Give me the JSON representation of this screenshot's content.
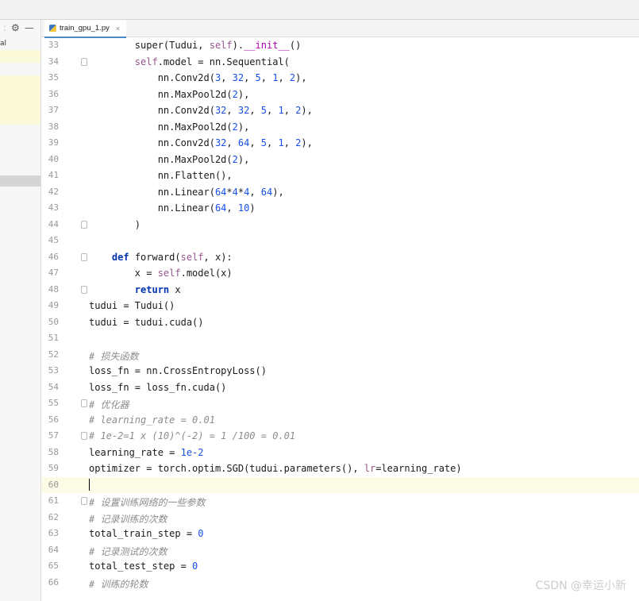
{
  "tab": {
    "filename": "train_gpu_1.py",
    "icon": "python-file-icon",
    "close_symbol": "×"
  },
  "left_panel": {
    "label": "al",
    "settings_icon": "gear-icon",
    "minimize_icon": "minus-icon"
  },
  "editor": {
    "current_line": 60,
    "lines": [
      {
        "n": "33",
        "t": "        super(Tudui, self).__init__()"
      },
      {
        "n": "34",
        "t": "        self.model = nn.Sequential("
      },
      {
        "n": "35",
        "t": "            nn.Conv2d(3, 32, 5, 1, 2),"
      },
      {
        "n": "36",
        "t": "            nn.MaxPool2d(2),"
      },
      {
        "n": "37",
        "t": "            nn.Conv2d(32, 32, 5, 1, 2),"
      },
      {
        "n": "38",
        "t": "            nn.MaxPool2d(2),"
      },
      {
        "n": "39",
        "t": "            nn.Conv2d(32, 64, 5, 1, 2),"
      },
      {
        "n": "40",
        "t": "            nn.MaxPool2d(2),"
      },
      {
        "n": "41",
        "t": "            nn.Flatten(),"
      },
      {
        "n": "42",
        "t": "            nn.Linear(64*4*4, 64),"
      },
      {
        "n": "43",
        "t": "            nn.Linear(64, 10)"
      },
      {
        "n": "44",
        "t": "        )"
      },
      {
        "n": "45",
        "t": ""
      },
      {
        "n": "46",
        "t": "    def forward(self, x):"
      },
      {
        "n": "47",
        "t": "        x = self.model(x)"
      },
      {
        "n": "48",
        "t": "        return x"
      },
      {
        "n": "49",
        "t": "tudui = Tudui()"
      },
      {
        "n": "50",
        "t": "tudui = tudui.cuda()"
      },
      {
        "n": "51",
        "t": ""
      },
      {
        "n": "52",
        "t": "# 损失函数"
      },
      {
        "n": "53",
        "t": "loss_fn = nn.CrossEntropyLoss()"
      },
      {
        "n": "54",
        "t": "loss_fn = loss_fn.cuda()"
      },
      {
        "n": "55",
        "t": "# 优化器"
      },
      {
        "n": "56",
        "t": "# learning_rate = 0.01"
      },
      {
        "n": "57",
        "t": "# 1e-2=1 x (10)^(-2) = 1 /100 = 0.01"
      },
      {
        "n": "58",
        "t": "learning_rate = 1e-2"
      },
      {
        "n": "59",
        "t": "optimizer = torch.optim.SGD(tudui.parameters(), lr=learning_rate)"
      },
      {
        "n": "60",
        "t": ""
      },
      {
        "n": "61",
        "t": "# 设置训练网络的一些参数"
      },
      {
        "n": "62",
        "t": "# 记录训练的次数"
      },
      {
        "n": "63",
        "t": "total_train_step = 0"
      },
      {
        "n": "64",
        "t": "# 记录测试的次数"
      },
      {
        "n": "65",
        "t": "total_test_step = 0"
      },
      {
        "n": "66",
        "t": "# 训练的轮数"
      }
    ]
  },
  "watermark": "CSDN @幸运小新"
}
